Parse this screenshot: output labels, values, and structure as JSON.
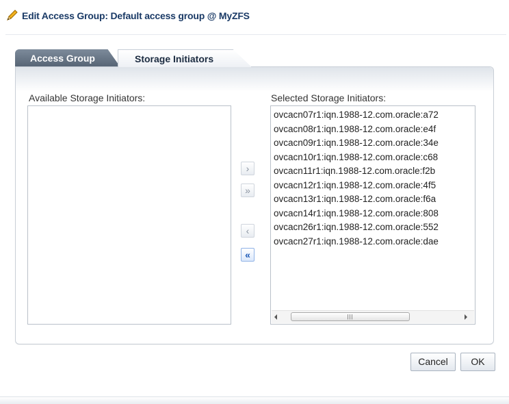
{
  "dialog": {
    "title": "Edit Access Group: Default access group @ MyZFS",
    "icon": "pencil-icon"
  },
  "tabs": [
    {
      "label": "Access Group",
      "selected": false
    },
    {
      "label": "Storage Initiators",
      "selected": true
    }
  ],
  "shuttle": {
    "available_label": "Available Storage Initiators:",
    "selected_label": "Selected Storage Initiators:",
    "available_items": [],
    "selected_items": [
      "ovcacn07r1:iqn.1988-12.com.oracle:a72",
      "ovcacn08r1:iqn.1988-12.com.oracle:e4f",
      "ovcacn09r1:iqn.1988-12.com.oracle:34e",
      "ovcacn10r1:iqn.1988-12.com.oracle:c68",
      "ovcacn11r1:iqn.1988-12.com.oracle:f2b",
      "ovcacn12r1:iqn.1988-12.com.oracle:4f5",
      "ovcacn13r1:iqn.1988-12.com.oracle:f6a",
      "ovcacn14r1:iqn.1988-12.com.oracle:808",
      "ovcacn26r1:iqn.1988-12.com.oracle:552",
      "ovcacn27r1:iqn.1988-12.com.oracle:dae"
    ],
    "buttons": {
      "move": "›",
      "move_all": "»",
      "remove": "‹",
      "remove_all": "«"
    }
  },
  "actions": {
    "cancel": "Cancel",
    "ok": "OK"
  },
  "colors": {
    "title": "#1a3a66",
    "accent": "#1a57b5"
  }
}
